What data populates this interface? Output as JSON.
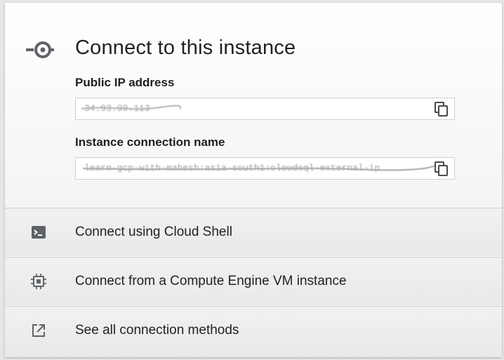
{
  "header": {
    "title": "Connect to this instance",
    "icon": "connect-plug-icon"
  },
  "fields": [
    {
      "label": "Public IP address",
      "value": "34.93.99.113",
      "icon": "copy-icon"
    },
    {
      "label": "Instance connection name",
      "value": "learn-gcp-with-mahesh:asia-south1:cloudsql-external-ip",
      "icon": "copy-icon"
    }
  ],
  "options": [
    {
      "label": "Connect using Cloud Shell",
      "icon": "cloud-shell-icon"
    },
    {
      "label": "Connect from a Compute Engine VM instance",
      "icon": "chip-icon"
    },
    {
      "label": "See all connection methods",
      "icon": "open-in-new-icon"
    }
  ],
  "colors": {
    "text": "#222222",
    "icon": "#5f6368",
    "row_background": "#ededed",
    "divider": "#cdcdcd"
  }
}
